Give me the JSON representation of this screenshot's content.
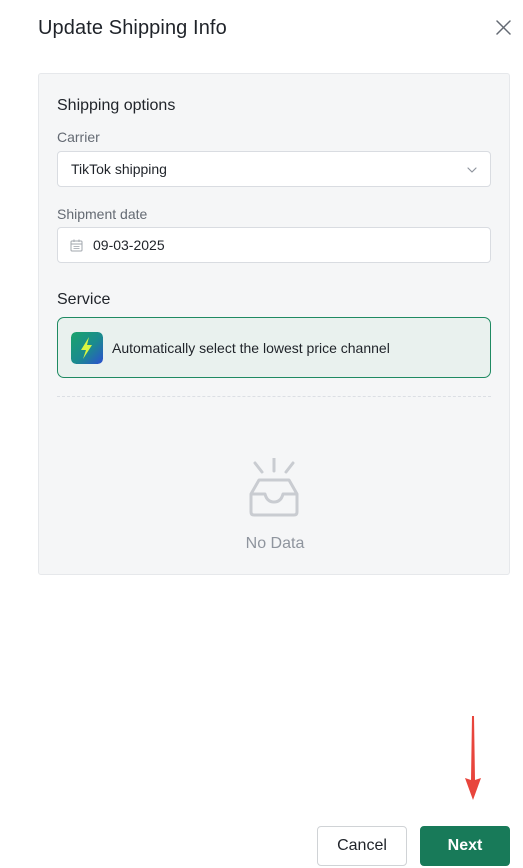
{
  "dialog": {
    "title": "Update Shipping Info"
  },
  "shipping_options": {
    "title": "Shipping options",
    "carrier_label": "Carrier",
    "carrier_value": "TikTok shipping",
    "shipment_date_label": "Shipment date",
    "shipment_date_value": "09-03-2025"
  },
  "service": {
    "title": "Service",
    "option_label": "Automatically select the lowest price channel"
  },
  "empty_state": {
    "text": "No Data"
  },
  "footer": {
    "cancel_label": "Cancel",
    "next_label": "Next"
  },
  "colors": {
    "accent": "#187a59",
    "service_border": "#1f8a62",
    "service_bg": "#e9f1ee",
    "annotation_arrow": "#e8453c"
  },
  "icons": [
    "close-icon",
    "chevron-down-icon",
    "calendar-icon",
    "lightning-logo-icon",
    "empty-inbox-icon",
    "red-arrow-annotation"
  ]
}
